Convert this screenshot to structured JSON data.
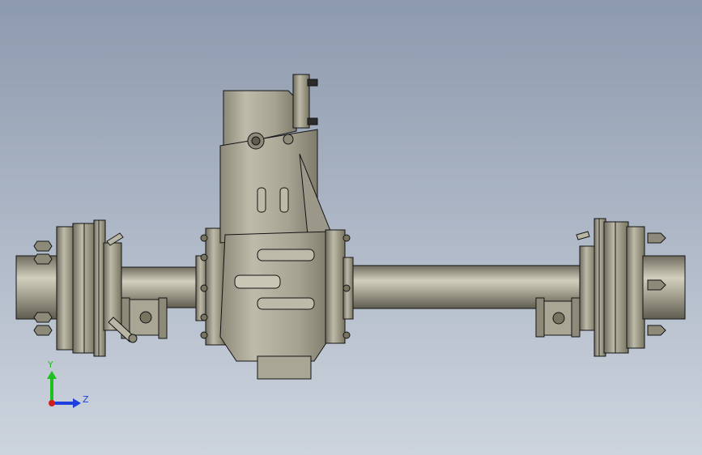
{
  "viewport": {
    "background_top": "#8d9aae",
    "background_bottom": "#cdd4de",
    "model_color": "#a7a493",
    "model_shade": "#7c7969",
    "model_light": "#cfccbb",
    "edge_color": "#141414"
  },
  "triad": {
    "y_label": "Y",
    "z_label": "Z",
    "y_color": "#1fbf1f",
    "z_color": "#1f3fdf",
    "x_color": "#d01f1f"
  }
}
